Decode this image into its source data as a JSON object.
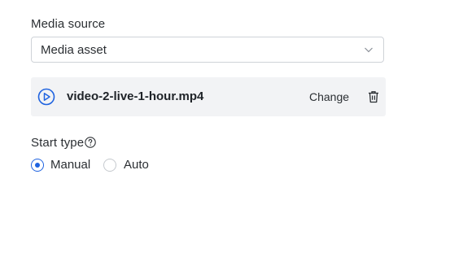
{
  "media_source": {
    "label": "Media source",
    "selected": "Media asset"
  },
  "file": {
    "name": "video-2-live-1-hour.mp4",
    "change_label": "Change"
  },
  "start_type": {
    "label": "Start type",
    "options": [
      {
        "label": "Manual",
        "selected": true
      },
      {
        "label": "Auto",
        "selected": false
      }
    ]
  },
  "colors": {
    "accent": "#1f63e0",
    "card_bg": "#f2f3f5",
    "border": "#cfd3d8"
  },
  "icons": [
    "chevron-down-icon",
    "play-circle-icon",
    "trash-icon",
    "help-icon"
  ]
}
